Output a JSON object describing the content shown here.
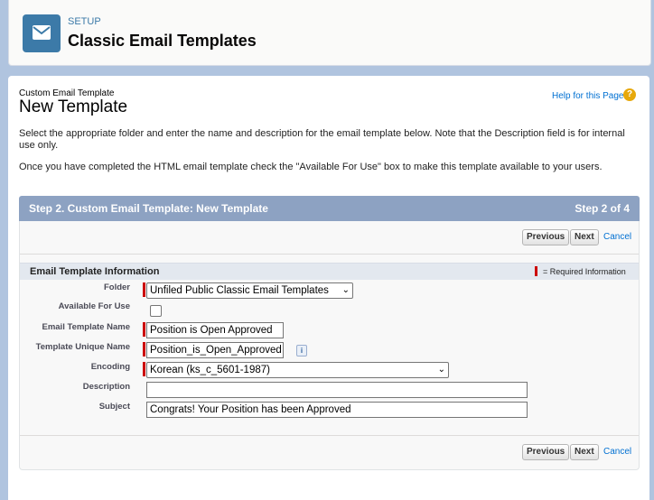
{
  "header": {
    "subtitle": "SETUP",
    "title": "Classic Email Templates",
    "icon": "envelope-icon"
  },
  "page": {
    "breadcrumb": "Custom Email Template",
    "title": "New Template",
    "help_label": "Help for this Page",
    "help_icon_glyph": "?",
    "intro_1": "Select the appropriate folder and enter the name and description for the email template below. Note that the Description field is for internal use only.",
    "intro_2": "Once you have completed the HTML email template check the \"Available For Use\" box to make this template available to your users."
  },
  "step": {
    "title": "Step 2. Custom Email Template: New Template",
    "counter": "Step 2 of 4"
  },
  "buttons": {
    "previous": "Previous",
    "next": "Next",
    "cancel": "Cancel"
  },
  "section": {
    "title": "Email Template Information",
    "required_legend": "= Required Information"
  },
  "form": {
    "folder": {
      "label": "Folder",
      "value": "Unfiled Public Classic Email Templates"
    },
    "available": {
      "label": "Available For Use",
      "checked": false
    },
    "template_name": {
      "label": "Email Template Name",
      "value": "Position is Open Approved"
    },
    "unique_name": {
      "label": "Template Unique Name",
      "value": "Position_is_Open_Approved",
      "info_glyph": "i"
    },
    "encoding": {
      "label": "Encoding",
      "value": "Korean (ks_c_5601-1987)"
    },
    "description": {
      "label": "Description",
      "value": ""
    },
    "subject": {
      "label": "Subject",
      "value": "Congrats! Your Position has been Approved"
    }
  },
  "colors": {
    "accent": "#3c7aa8",
    "step_bar": "#8da2c2",
    "required": "#cc0000",
    "link": "#0070d2"
  }
}
